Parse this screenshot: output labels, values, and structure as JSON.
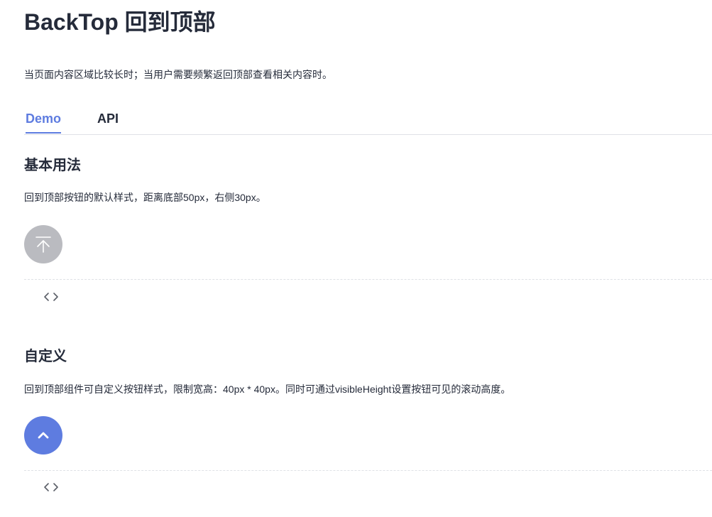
{
  "page": {
    "title": "BackTop 回到顶部",
    "description": "当页面内容区域比较长时；当用户需要频繁返回顶部查看相关内容时。"
  },
  "tabs": [
    {
      "label": "Demo",
      "active": true
    },
    {
      "label": "API",
      "active": false
    }
  ],
  "sections": [
    {
      "title": "基本用法",
      "description": "回到顶部按钮的默认样式，距离底部50px，右侧30px。",
      "button_icon": "arrow-up-to-top-icon",
      "button_color": "#babbc0"
    },
    {
      "title": "自定义",
      "description": "回到顶部组件可自定义按钮样式，限制宽高：40px * 40px。同时可通过visibleHeight设置按钮可见的滚动高度。",
      "button_icon": "chevron-up-icon",
      "button_color": "#5e7ce0"
    }
  ],
  "code_toggle_icon": "code-icon",
  "colors": {
    "accent": "#5e7ce0",
    "text": "#252b3a",
    "border": "#dfe1e6"
  }
}
